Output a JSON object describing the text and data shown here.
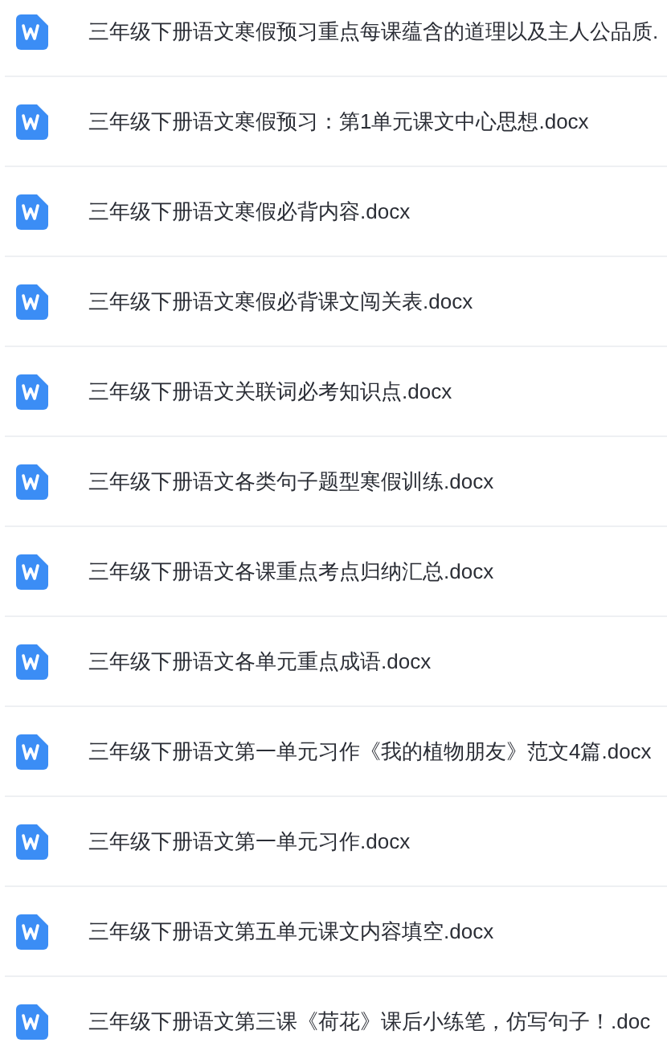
{
  "files": [
    {
      "name": "三年级下册语文寒假预习重点每课蕴含的道理以及主人公品质."
    },
    {
      "name": "三年级下册语文寒假预习：第1单元课文中心思想.docx"
    },
    {
      "name": "三年级下册语文寒假必背内容.docx"
    },
    {
      "name": "三年级下册语文寒假必背课文闯关表.docx"
    },
    {
      "name": "三年级下册语文关联词必考知识点.docx"
    },
    {
      "name": "三年级下册语文各类句子题型寒假训练.docx"
    },
    {
      "name": "三年级下册语文各课重点考点归纳汇总.docx"
    },
    {
      "name": "三年级下册语文各单元重点成语.docx"
    },
    {
      "name": "三年级下册语文第一单元习作《我的植物朋友》范文4篇.docx"
    },
    {
      "name": "三年级下册语文第一单元习作.docx"
    },
    {
      "name": "三年级下册语文第五单元课文内容填空.docx"
    },
    {
      "name": "三年级下册语文第三课《荷花》课后小练笔，仿写句子！.doc"
    }
  ]
}
